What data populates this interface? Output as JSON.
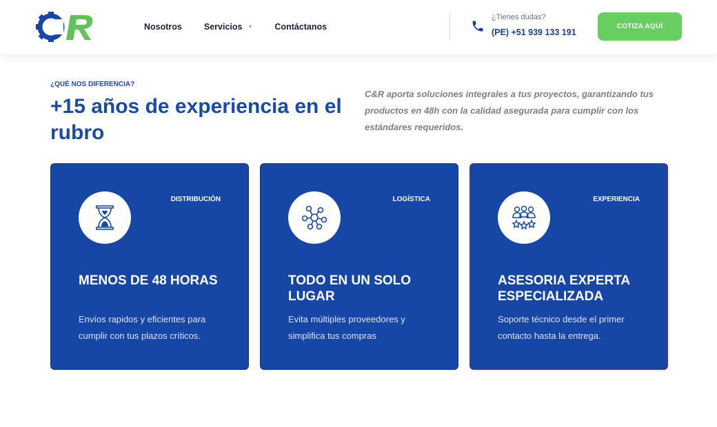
{
  "header": {
    "logo_text": "CR",
    "nav": [
      {
        "label": "Nosotros"
      },
      {
        "label": "Servicios"
      },
      {
        "label": "Contáctanos"
      }
    ],
    "phone_question": "¿Tienes dudas?",
    "phone_number": "(PE) +51 939 133 191",
    "cta_label": "COTIZA AQUÍ"
  },
  "intro": {
    "eyebrow": "¿QUÉ NOS DIFERENCIA?",
    "headline": "+15 años de experiencia en el rubro",
    "text": "C&R aporta soluciones integrales a tus proyectos, garantizando tus productos en 48h con la calidad asegurada para cumplir con los estándares requeridos."
  },
  "cards": [
    {
      "tag": "DISTRIBUCIÓN",
      "title": "MENOS DE 48 HORAS",
      "desc": "Envíos rapidos y eficientes para cumplir con tus plazos críticos.",
      "icon": "hourglass-icon"
    },
    {
      "tag": "LOGÍSTICA",
      "title": "TODO EN UN SOLO LUGAR",
      "desc": "Evita múltiples proveedores y simplifica tus compras",
      "icon": "network-icon"
    },
    {
      "tag": "EXPERIENCIA",
      "title": "ASESORIA EXPERTA ESPECIALIZADA",
      "desc": "Soporte técnico desde el primer contacto hasta la entrega.",
      "icon": "team-rating-icon"
    }
  ],
  "colors": {
    "brand_blue": "#1646a6",
    "accent_green": "#67cf62"
  }
}
